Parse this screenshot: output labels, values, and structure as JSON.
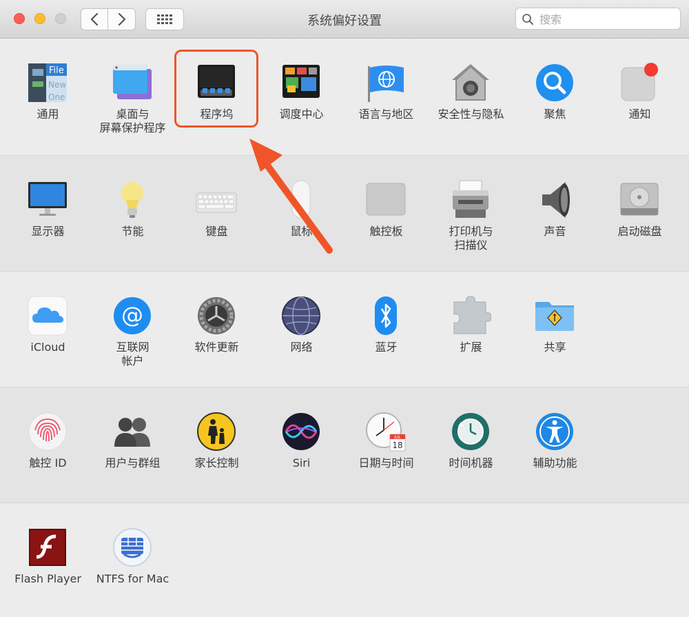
{
  "window": {
    "title": "系统偏好设置"
  },
  "search": {
    "placeholder": "搜索"
  },
  "rows": [
    [
      {
        "name": "general",
        "l1": "通用",
        "l2": ""
      },
      {
        "name": "desktop-screensaver",
        "l1": "桌面与",
        "l2": "屏幕保护程序"
      },
      {
        "name": "dock",
        "l1": "程序坞",
        "l2": ""
      },
      {
        "name": "mission-control",
        "l1": "调度中心",
        "l2": ""
      },
      {
        "name": "language-region",
        "l1": "语言与地区",
        "l2": ""
      },
      {
        "name": "security-privacy",
        "l1": "安全性与隐私",
        "l2": ""
      },
      {
        "name": "spotlight",
        "l1": "聚焦",
        "l2": ""
      },
      {
        "name": "notifications",
        "l1": "通知",
        "l2": ""
      }
    ],
    [
      {
        "name": "displays",
        "l1": "显示器",
        "l2": ""
      },
      {
        "name": "energy-saver",
        "l1": "节能",
        "l2": ""
      },
      {
        "name": "keyboard",
        "l1": "键盘",
        "l2": ""
      },
      {
        "name": "mouse",
        "l1": "鼠标",
        "l2": ""
      },
      {
        "name": "trackpad",
        "l1": "触控板",
        "l2": ""
      },
      {
        "name": "printers-scanners",
        "l1": "打印机与",
        "l2": "扫描仪"
      },
      {
        "name": "sound",
        "l1": "声音",
        "l2": ""
      },
      {
        "name": "startup-disk",
        "l1": "启动磁盘",
        "l2": ""
      }
    ],
    [
      {
        "name": "icloud",
        "l1": "iCloud",
        "l2": ""
      },
      {
        "name": "internet-accounts",
        "l1": "互联网",
        "l2": "帐户"
      },
      {
        "name": "software-update",
        "l1": "软件更新",
        "l2": ""
      },
      {
        "name": "network",
        "l1": "网络",
        "l2": ""
      },
      {
        "name": "bluetooth",
        "l1": "蓝牙",
        "l2": ""
      },
      {
        "name": "extensions",
        "l1": "扩展",
        "l2": ""
      },
      {
        "name": "sharing",
        "l1": "共享",
        "l2": ""
      }
    ],
    [
      {
        "name": "touch-id",
        "l1": "触控 ID",
        "l2": ""
      },
      {
        "name": "users-groups",
        "l1": "用户与群组",
        "l2": ""
      },
      {
        "name": "parental-controls",
        "l1": "家长控制",
        "l2": ""
      },
      {
        "name": "siri",
        "l1": "Siri",
        "l2": ""
      },
      {
        "name": "date-time",
        "l1": "日期与时间",
        "l2": ""
      },
      {
        "name": "time-machine",
        "l1": "时间机器",
        "l2": ""
      },
      {
        "name": "accessibility",
        "l1": "辅助功能",
        "l2": ""
      }
    ],
    [
      {
        "name": "flash-player",
        "l1": "Flash Player",
        "l2": ""
      },
      {
        "name": "ntfs-for-mac",
        "l1": "NTFS for Mac",
        "l2": ""
      }
    ]
  ],
  "icon_text": {
    "general_a": "File",
    "general_b": "New",
    "general_c": "One",
    "calendar_month": "JUL",
    "calendar_day": "18"
  },
  "colors": {
    "highlight": "#f0552a",
    "notification_dot": "#f23a30",
    "accent_blue": "#1e88e5"
  }
}
